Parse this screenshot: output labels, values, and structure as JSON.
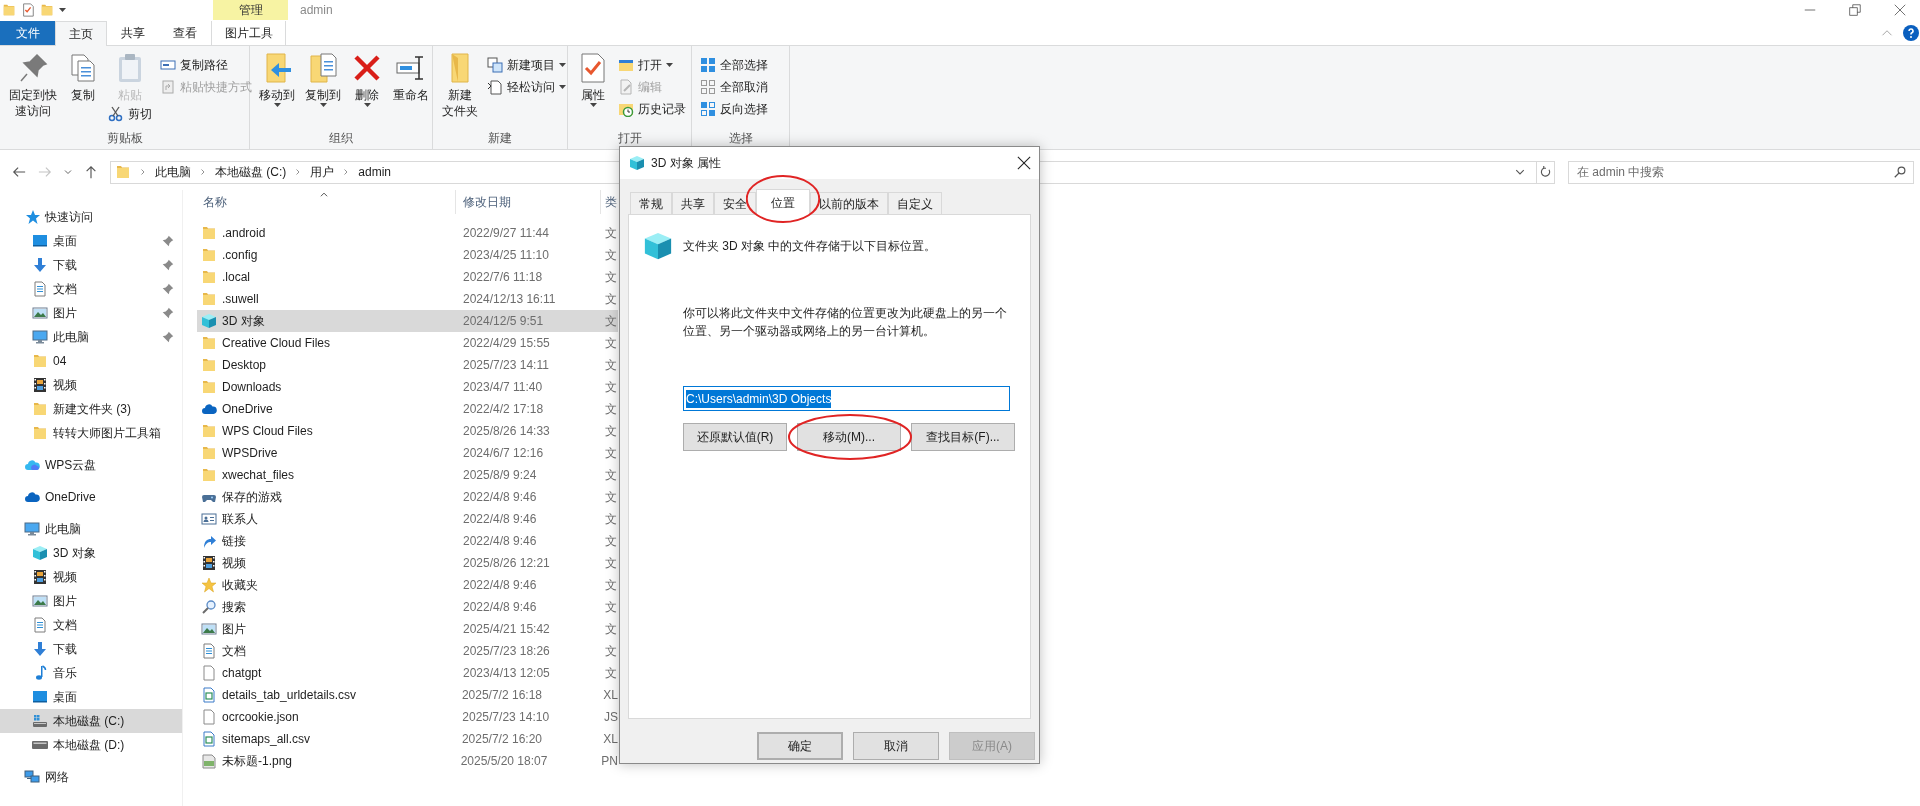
{
  "window": {
    "title": "admin"
  },
  "ribbon": {
    "tabs": [
      {
        "label": "文件",
        "kind": "file",
        "selected": false
      },
      {
        "label": "主页",
        "kind": "normal",
        "selected": true
      },
      {
        "label": "共享",
        "kind": "normal",
        "selected": false
      },
      {
        "label": "查看",
        "kind": "normal",
        "selected": false
      },
      {
        "label": "图片工具",
        "kind": "context",
        "context": "管理",
        "selected": false
      }
    ],
    "groups": [
      {
        "label": "剪贴板",
        "commands": [
          {
            "label": [
              "固定到快",
              "速访问"
            ],
            "kind": "large",
            "disabled": false,
            "dropdown": false
          },
          {
            "label": "复制",
            "kind": "large",
            "disabled": false,
            "dropdown": false
          },
          {
            "label": "粘贴",
            "kind": "large",
            "disabled": true,
            "dropdown": false
          },
          {
            "label": "剪切",
            "kind": "under",
            "disabled": false,
            "dropdown": false
          },
          {
            "label": "复制路径",
            "kind": "small",
            "disabled": false,
            "dropdown": false
          },
          {
            "label": "粘贴快捷方式",
            "kind": "small",
            "disabled": true,
            "dropdown": false
          }
        ]
      },
      {
        "label": "组织",
        "commands": [
          {
            "label": "移动到",
            "kind": "large",
            "disabled": false,
            "dropdown": true
          },
          {
            "label": "复制到",
            "kind": "large",
            "disabled": false,
            "dropdown": true
          },
          {
            "label": "删除",
            "kind": "large",
            "disabled": false,
            "dropdown": true
          },
          {
            "label": "重命名",
            "kind": "large",
            "disabled": false,
            "dropdown": false
          }
        ]
      },
      {
        "label": "新建",
        "commands": [
          {
            "label": [
              "新建",
              "文件夹"
            ],
            "kind": "large",
            "disabled": false,
            "dropdown": false
          },
          {
            "label": "新建项目",
            "kind": "small",
            "disabled": false,
            "dropdown": true
          },
          {
            "label": "轻松访问",
            "kind": "small",
            "disabled": false,
            "dropdown": true
          }
        ]
      },
      {
        "label": "打开",
        "commands": [
          {
            "label": "属性",
            "kind": "large",
            "disabled": false,
            "dropdown": true
          },
          {
            "label": "打开",
            "kind": "small",
            "disabled": false,
            "dropdown": true
          },
          {
            "label": "编辑",
            "kind": "small",
            "disabled": true,
            "dropdown": false
          },
          {
            "label": "历史记录",
            "kind": "small",
            "disabled": false,
            "dropdown": false
          }
        ]
      },
      {
        "label": "选择",
        "commands": [
          {
            "label": "全部选择",
            "kind": "small",
            "disabled": false,
            "dropdown": false
          },
          {
            "label": "全部取消",
            "kind": "small",
            "disabled": false,
            "dropdown": false
          },
          {
            "label": "反向选择",
            "kind": "small",
            "disabled": false,
            "dropdown": false
          }
        ]
      }
    ]
  },
  "address_bar": {
    "path": [
      "此电脑",
      "本地磁盘 (C:)",
      "用户",
      "admin"
    ],
    "search_placeholder": "在 admin 中搜索"
  },
  "navigation": [
    {
      "label": "快速访问",
      "kind": "quick",
      "selected": false,
      "children": [
        {
          "label": "桌面",
          "kind": "desktop",
          "pinned": true,
          "selected": false
        },
        {
          "label": "下载",
          "kind": "downloads",
          "pinned": true,
          "selected": false
        },
        {
          "label": "文档",
          "kind": "documents",
          "pinned": true,
          "selected": false
        },
        {
          "label": "图片",
          "kind": "pictures",
          "pinned": true,
          "selected": false
        },
        {
          "label": "此电脑",
          "kind": "pc",
          "pinned": true,
          "selected": false
        },
        {
          "label": "04",
          "kind": "folder",
          "pinned": false,
          "selected": false
        },
        {
          "label": "视频",
          "kind": "videos",
          "pinned": false,
          "selected": false
        },
        {
          "label": "新建文件夹 (3)",
          "kind": "folder",
          "pinned": false,
          "selected": false
        },
        {
          "label": "转转大师图片工具箱",
          "kind": "folder",
          "pinned": false,
          "selected": false
        }
      ]
    },
    {
      "label": "WPS云盘",
      "kind": "wps",
      "selected": false
    },
    {
      "label": "OneDrive",
      "kind": "onedrive",
      "selected": false
    },
    {
      "label": "此电脑",
      "kind": "pc",
      "selected": false,
      "children": [
        {
          "label": "3D 对象",
          "kind": "objects",
          "pinned": false,
          "selected": false
        },
        {
          "label": "视频",
          "kind": "videos",
          "pinned": false,
          "selected": false
        },
        {
          "label": "图片",
          "kind": "pictures",
          "pinned": false,
          "selected": false
        },
        {
          "label": "文档",
          "kind": "documents",
          "pinned": false,
          "selected": false
        },
        {
          "label": "下载",
          "kind": "downloads",
          "pinned": false,
          "selected": false
        },
        {
          "label": "音乐",
          "kind": "music",
          "pinned": false,
          "selected": false
        },
        {
          "label": "桌面",
          "kind": "desktop",
          "pinned": false,
          "selected": false
        },
        {
          "label": "本地磁盘 (C:)",
          "kind": "systemdrive",
          "pinned": false,
          "selected": true
        },
        {
          "label": "本地磁盘 (D:)",
          "kind": "drive",
          "pinned": false,
          "selected": false
        }
      ]
    },
    {
      "label": "网络",
      "kind": "network",
      "selected": false
    }
  ],
  "file_list": {
    "columns": [
      {
        "label": "名称",
        "sorted": true
      },
      {
        "label": "修改日期",
        "sorted": false
      },
      {
        "label": "类",
        "sorted": false
      }
    ],
    "rows": [
      {
        "name": ".android",
        "kind": "folder",
        "modified": "2022/9/27 11:44",
        "type": "文",
        "selected": false
      },
      {
        "name": ".config",
        "kind": "folder",
        "modified": "2023/4/25 11:10",
        "type": "文",
        "selected": false
      },
      {
        "name": ".local",
        "kind": "folder",
        "modified": "2022/7/6 11:18",
        "type": "文",
        "selected": false
      },
      {
        "name": ".suwell",
        "kind": "folder",
        "modified": "2024/12/13 16:11",
        "type": "文",
        "selected": false
      },
      {
        "name": "3D 对象",
        "kind": "objects",
        "modified": "2024/12/5 9:51",
        "type": "文",
        "selected": true
      },
      {
        "name": "Creative Cloud Files",
        "kind": "folder",
        "modified": "2022/4/29 15:55",
        "type": "文",
        "selected": false
      },
      {
        "name": "Desktop",
        "kind": "folder",
        "modified": "2025/7/23 14:11",
        "type": "文",
        "selected": false
      },
      {
        "name": "Downloads",
        "kind": "folder",
        "modified": "2023/4/7 11:40",
        "type": "文",
        "selected": false
      },
      {
        "name": "OneDrive",
        "kind": "onedrive",
        "modified": "2022/4/2 17:18",
        "type": "文",
        "selected": false
      },
      {
        "name": "WPS Cloud Files",
        "kind": "folder",
        "modified": "2025/8/26 14:33",
        "type": "文",
        "selected": false
      },
      {
        "name": "WPSDrive",
        "kind": "folder",
        "modified": "2024/6/7 12:16",
        "type": "文",
        "selected": false
      },
      {
        "name": "xwechat_files",
        "kind": "folder",
        "modified": "2025/8/9 9:24",
        "type": "文",
        "selected": false
      },
      {
        "name": "保存的游戏",
        "kind": "games",
        "modified": "2022/4/8 9:46",
        "type": "文",
        "selected": false
      },
      {
        "name": "联系人",
        "kind": "contacts",
        "modified": "2022/4/8 9:46",
        "type": "文",
        "selected": false
      },
      {
        "name": "链接",
        "kind": "links",
        "modified": "2022/4/8 9:46",
        "type": "文",
        "selected": false
      },
      {
        "name": "视频",
        "kind": "videos",
        "modified": "2025/8/26 12:21",
        "type": "文",
        "selected": false
      },
      {
        "name": "收藏夹",
        "kind": "favorites",
        "modified": "2022/4/8 9:46",
        "type": "文",
        "selected": false
      },
      {
        "name": "搜索",
        "kind": "searches",
        "modified": "2022/4/8 9:46",
        "type": "文",
        "selected": false
      },
      {
        "name": "图片",
        "kind": "pictures",
        "modified": "2025/4/21 15:42",
        "type": "文",
        "selected": false
      },
      {
        "name": "文档",
        "kind": "documents",
        "modified": "2025/7/23 18:26",
        "type": "文",
        "selected": false
      },
      {
        "name": "chatgpt",
        "kind": "file",
        "modified": "2023/4/13 12:05",
        "type": "文",
        "selected": false
      },
      {
        "name": "details_tab_urldetails.csv",
        "kind": "csv",
        "modified": "2025/7/2 16:18",
        "type": "XL",
        "selected": false
      },
      {
        "name": "ocrcookie.json",
        "kind": "file",
        "modified": "2025/7/23 14:10",
        "type": "JS",
        "selected": false
      },
      {
        "name": "sitemaps_all.csv",
        "kind": "csv",
        "modified": "2025/7/2 16:20",
        "type": "XL",
        "selected": false
      },
      {
        "name": "未标题-1.png",
        "kind": "png",
        "modified": "2025/5/20 18:07",
        "type": "PN",
        "selected": false
      }
    ]
  },
  "dialog": {
    "title": "3D 对象 属性",
    "tabs": [
      {
        "label": "常规",
        "selected": false,
        "circled": false
      },
      {
        "label": "共享",
        "selected": false,
        "circled": false
      },
      {
        "label": "安全",
        "selected": false,
        "circled": false
      },
      {
        "label": "位置",
        "selected": true,
        "circled": true
      },
      {
        "label": "以前的版本",
        "selected": false,
        "circled": false
      },
      {
        "label": "自定义",
        "selected": false,
        "circled": false
      }
    ],
    "heading": "文件夹 3D 对象 中的文件存储于以下目标位置。",
    "description": "你可以将此文件夹中文件存储的位置更改为此硬盘上的另一个位置、另一个驱动器或网络上的另一台计算机。",
    "location": {
      "value": "C:\\Users\\admin\\3D Objects",
      "selected": true
    },
    "location_buttons": [
      {
        "label": "还原默认值(R)",
        "circled": false
      },
      {
        "label": "移动(M)...",
        "circled": true
      },
      {
        "label": "查找目标(F)...",
        "circled": false
      }
    ],
    "footer_buttons": [
      {
        "label": "确定",
        "kind": "default",
        "disabled": false
      },
      {
        "label": "取消",
        "kind": "normal",
        "disabled": false
      },
      {
        "label": "应用(A)",
        "kind": "normal",
        "disabled": true
      }
    ]
  }
}
